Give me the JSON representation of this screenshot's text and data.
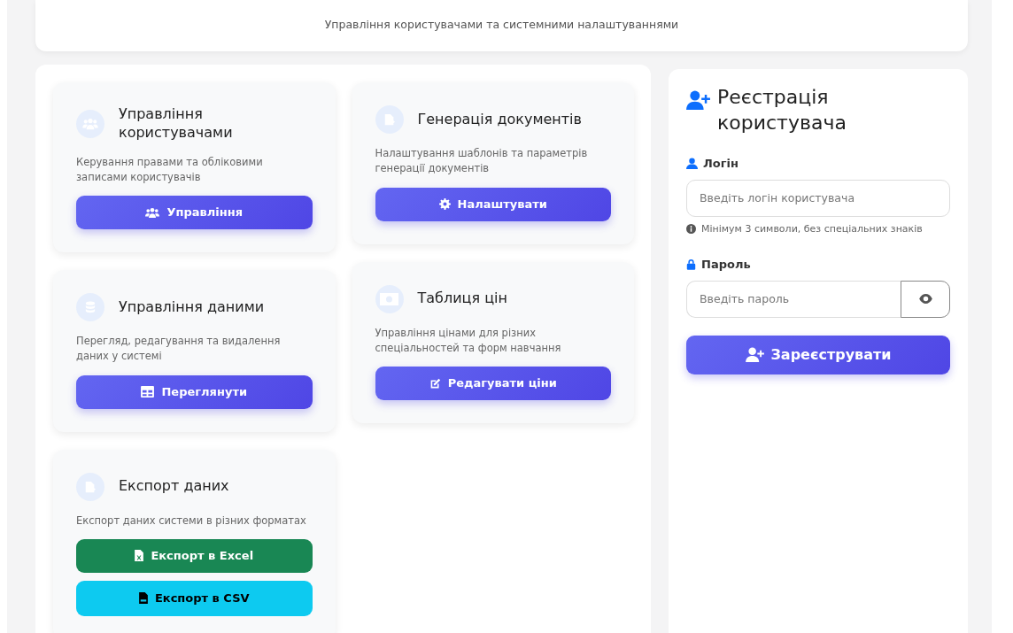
{
  "header": {
    "subtitle": "Управління користувачами та системними налаштуваннями"
  },
  "columns": [
    [
      {
        "title": "Управління користувачами",
        "description": "Керування правами та обліковими записами користувачів",
        "buttons": [
          {
            "label": "Управління",
            "kind": "primary"
          }
        ]
      },
      {
        "title": "Управління даними",
        "description": "Перегляд, редагування та видалення даних у системі",
        "buttons": [
          {
            "label": "Переглянути",
            "kind": "primary"
          }
        ]
      },
      {
        "title": "Експорт даних",
        "description": "Експорт даних системи в різних форматах",
        "buttons": [
          {
            "label": "Експорт в Excel",
            "kind": "success"
          },
          {
            "label": "Експорт в CSV",
            "kind": "info"
          }
        ]
      }
    ],
    [
      {
        "title": "Генерація документів",
        "description": "Налаштування шаблонів та параметрів генерації документів",
        "buttons": [
          {
            "label": "Налаштувати",
            "kind": "primary"
          }
        ]
      },
      {
        "title": "Таблиця цін",
        "description": "Управління цінами для різних спеціальностей та форм навчання",
        "buttons": [
          {
            "label": "Редагувати ціни",
            "kind": "primary"
          }
        ]
      }
    ]
  ],
  "registration": {
    "title": "Реєстрація користувача",
    "fields": [
      {
        "kind": "text",
        "label": "Логін",
        "placeholder": "Введіть логін користувача",
        "hint": "Мінімум 3 символи, без спеціальних знаків"
      },
      {
        "kind": "password",
        "label": "Пароль",
        "placeholder": "Введіть пароль"
      }
    ],
    "submit": {
      "label": "Зареєструвати"
    }
  }
}
